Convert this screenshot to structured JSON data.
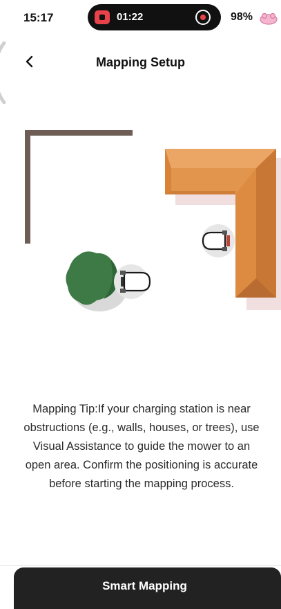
{
  "status_bar": {
    "time": "15:17",
    "recording_time": "01:22",
    "battery": "98%"
  },
  "header": {
    "back_icon": "chevron-left-icon",
    "title": "Mapping Setup"
  },
  "illustration": {
    "wall_color": "#6e5d54",
    "house_color": "#e2954c",
    "bush_color": "#3d7a45"
  },
  "tip": {
    "text": "Mapping Tip:If your charging station is near obstructions (e.g., walls, houses, or trees), use Visual Assistance to guide the mower to an open area. Confirm the positioning is accurate before starting the mapping process."
  },
  "actions": {
    "primary_label": "Smart Mapping",
    "primary_color": "#222222"
  }
}
